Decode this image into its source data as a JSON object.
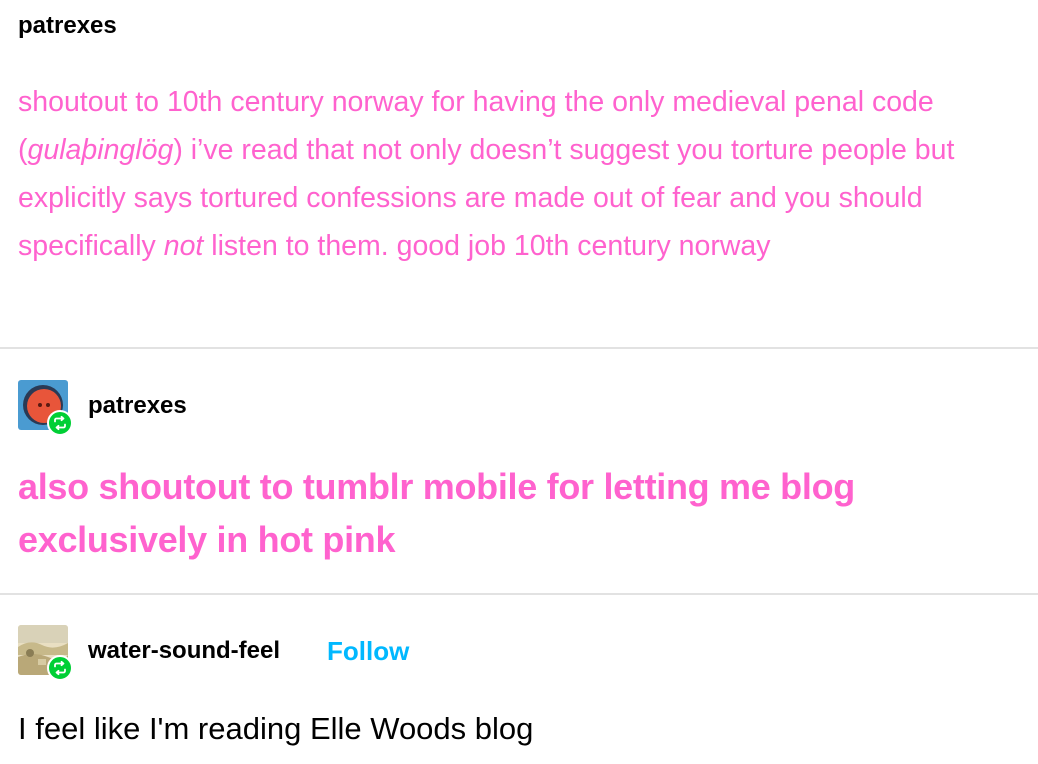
{
  "original_post": {
    "username": "patrexes",
    "body_part1": "shoutout to 10th century norway for having the only medieval penal code (",
    "body_italic1": "gulaþinglög",
    "body_part2": ") i’ve read that not only doesn’t suggest you torture people but explicitly says tortured confessions are made out of fear and you should specifically ",
    "body_italic2": "not",
    "body_part3": " listen to them. good job 10th century norway",
    "text_color": "#ff62ce"
  },
  "reblog_1": {
    "username": "patrexes",
    "avatar_icon": "red-ball-avatar-icon",
    "badge_icon": "reblog-icon",
    "body": "also shoutout to tumblr mobile for letting me blog exclusively in hot pink",
    "text_color": "#ff62ce"
  },
  "reblog_2": {
    "username": "water-sound-feel",
    "follow_label": "Follow",
    "avatar_icon": "landscape-avatar-icon",
    "badge_icon": "reblog-icon",
    "body": "I feel like I'm reading Elle Woods blog",
    "follow_color": "#00b8ff"
  },
  "colors": {
    "pink": "#ff62ce",
    "reblog_green": "#00cf35",
    "divider": "#e2e2e2",
    "follow_blue": "#00b8ff"
  }
}
